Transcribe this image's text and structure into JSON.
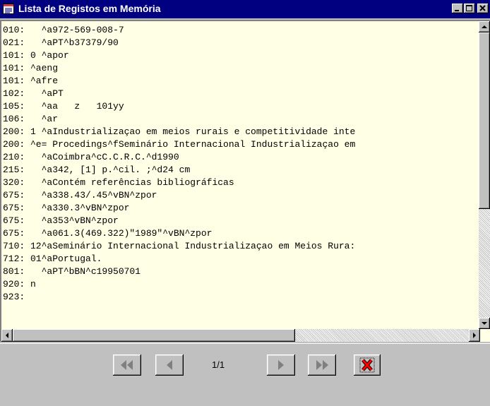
{
  "window": {
    "title": "Lista de Registos em Memória",
    "title_icon": "list-window-icon",
    "controls": [
      "minimize-icon",
      "maximize-icon",
      "close-icon"
    ]
  },
  "record_lines": [
    "010:   ^a972-569-008-7",
    "021:   ^aPT^b37379/90",
    "101: 0 ^apor",
    "101: ^aeng",
    "101: ^afre",
    "102:   ^aPT",
    "105:   ^aa   z   101yy",
    "106:   ^ar",
    "200: 1 ^aIndustrializaçao em meios rurais e competitividade inte",
    "200: ^e= Procedings^fSeminário Internacional Industrializaçao em",
    "210:   ^aCoimbra^cC.C.R.C.^d1990",
    "215:   ^a342, [1] p.^cil. ;^d24 cm",
    "320:   ^aContém referências bibliográficas",
    "675:   ^a338.43/.45^vBN^zpor",
    "675:   ^a330.3^vBN^zpor",
    "675:   ^a353^vBN^zpor",
    "675:   ^a061.3(469.322)\"1989\"^vBN^zpor",
    "710: 12^aSeminário Internacional Industrializaçao em Meios Rura:",
    "712: 01^aPortugal.",
    "801:   ^aPT^bBN^c19950701",
    "920: n",
    "923:"
  ],
  "toolbar": {
    "page_indicator": "1/1",
    "buttons": [
      "first-record-icon",
      "previous-record-icon",
      "next-record-icon",
      "last-record-icon",
      "close-red-x-icon"
    ]
  },
  "colors": {
    "title_bar": "#000080",
    "text_background": "#ffffe6",
    "close_x": "#ff0000"
  }
}
